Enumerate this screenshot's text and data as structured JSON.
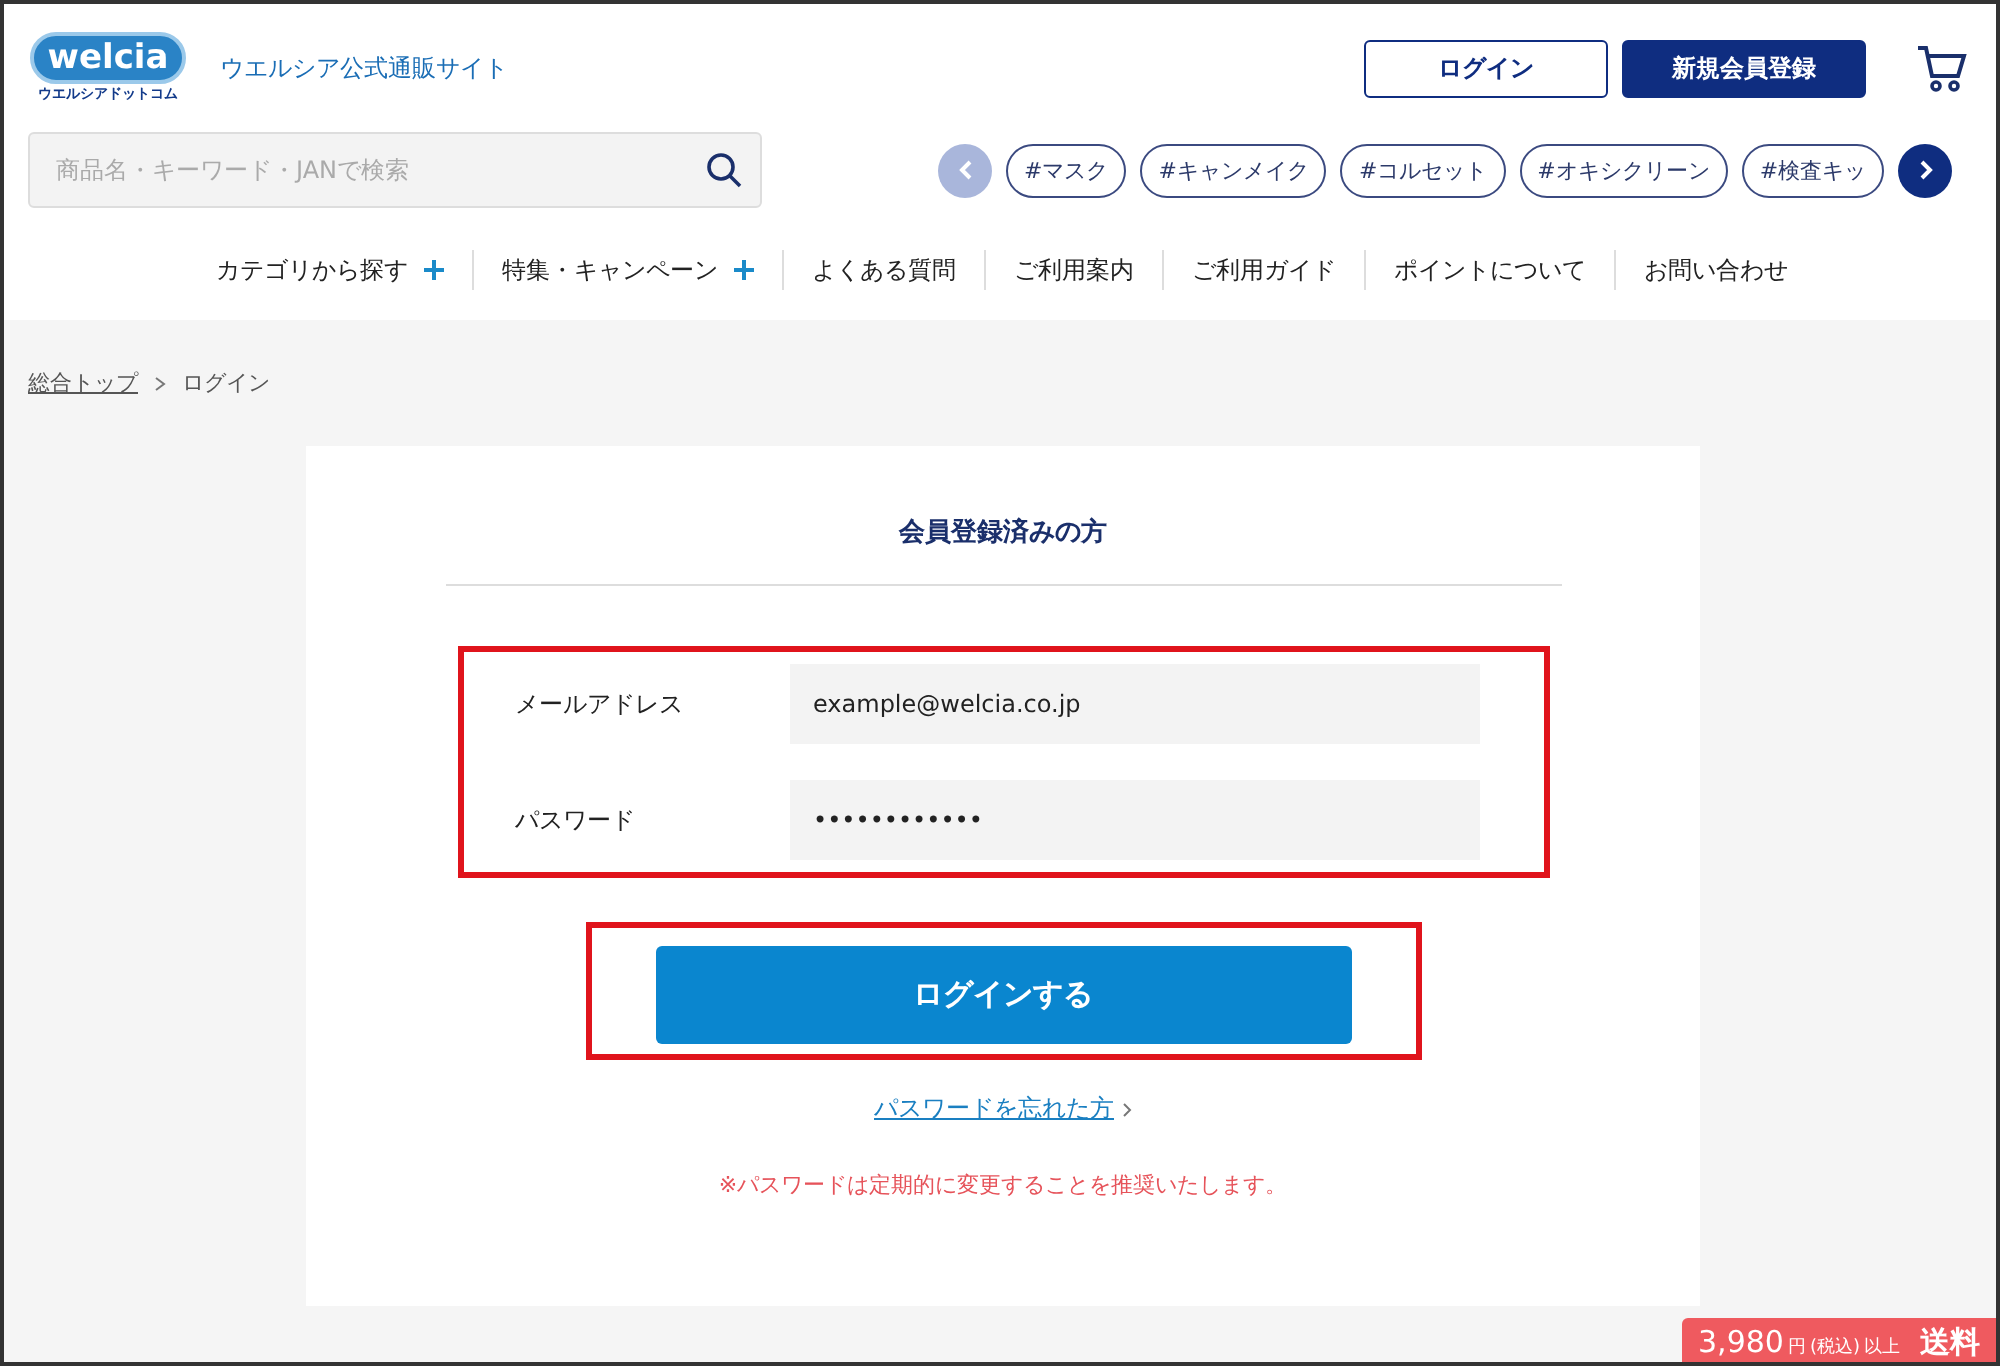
{
  "header": {
    "logo": {
      "name": "welcia",
      "tagline": "ウエルシアドットコム"
    },
    "site_title": "ウエルシア公式通販サイト",
    "buttons": [
      {
        "label": "ログイン",
        "kind": "outline"
      },
      {
        "label": "新規会員登録",
        "kind": "filled"
      }
    ]
  },
  "search": {
    "placeholder": "商品名・キーワード・JANで検索"
  },
  "tags": [
    {
      "label": "#マスク"
    },
    {
      "label": "#キャンメイク"
    },
    {
      "label": "#コルセット"
    },
    {
      "label": "#オキシクリーン"
    },
    {
      "label": "#検査キッ"
    }
  ],
  "nav": [
    {
      "label": "カテゴリから探す",
      "expandable": true
    },
    {
      "label": "特集・キャンペーン",
      "expandable": true
    },
    {
      "label": "よくある質問",
      "expandable": false
    },
    {
      "label": "ご利用案内",
      "expandable": false
    },
    {
      "label": "ご利用ガイド",
      "expandable": false
    },
    {
      "label": "ポイントについて",
      "expandable": false
    },
    {
      "label": "お問い合わせ",
      "expandable": false
    }
  ],
  "breadcrumb": [
    {
      "label": "総合トップ",
      "link": true
    },
    {
      "label": "ログイン",
      "link": false
    }
  ],
  "login": {
    "title": "会員登録済みの方",
    "highlighted": true,
    "fields": [
      {
        "label": "メールアドレス",
        "value": "example@welcia.co.jp"
      },
      {
        "label": "パスワード",
        "value": "••••••••••••"
      }
    ],
    "submit": {
      "label": "ログインする",
      "highlighted": true
    },
    "forgot_link": "パスワードを忘れた方",
    "notice": "※パスワードは定期的に変更することを推奨いたします。"
  },
  "shipping_badge": {
    "amount": "3,980",
    "unit": "円",
    "tax": "(税込)",
    "suffix": "以上",
    "label": "送料"
  }
}
